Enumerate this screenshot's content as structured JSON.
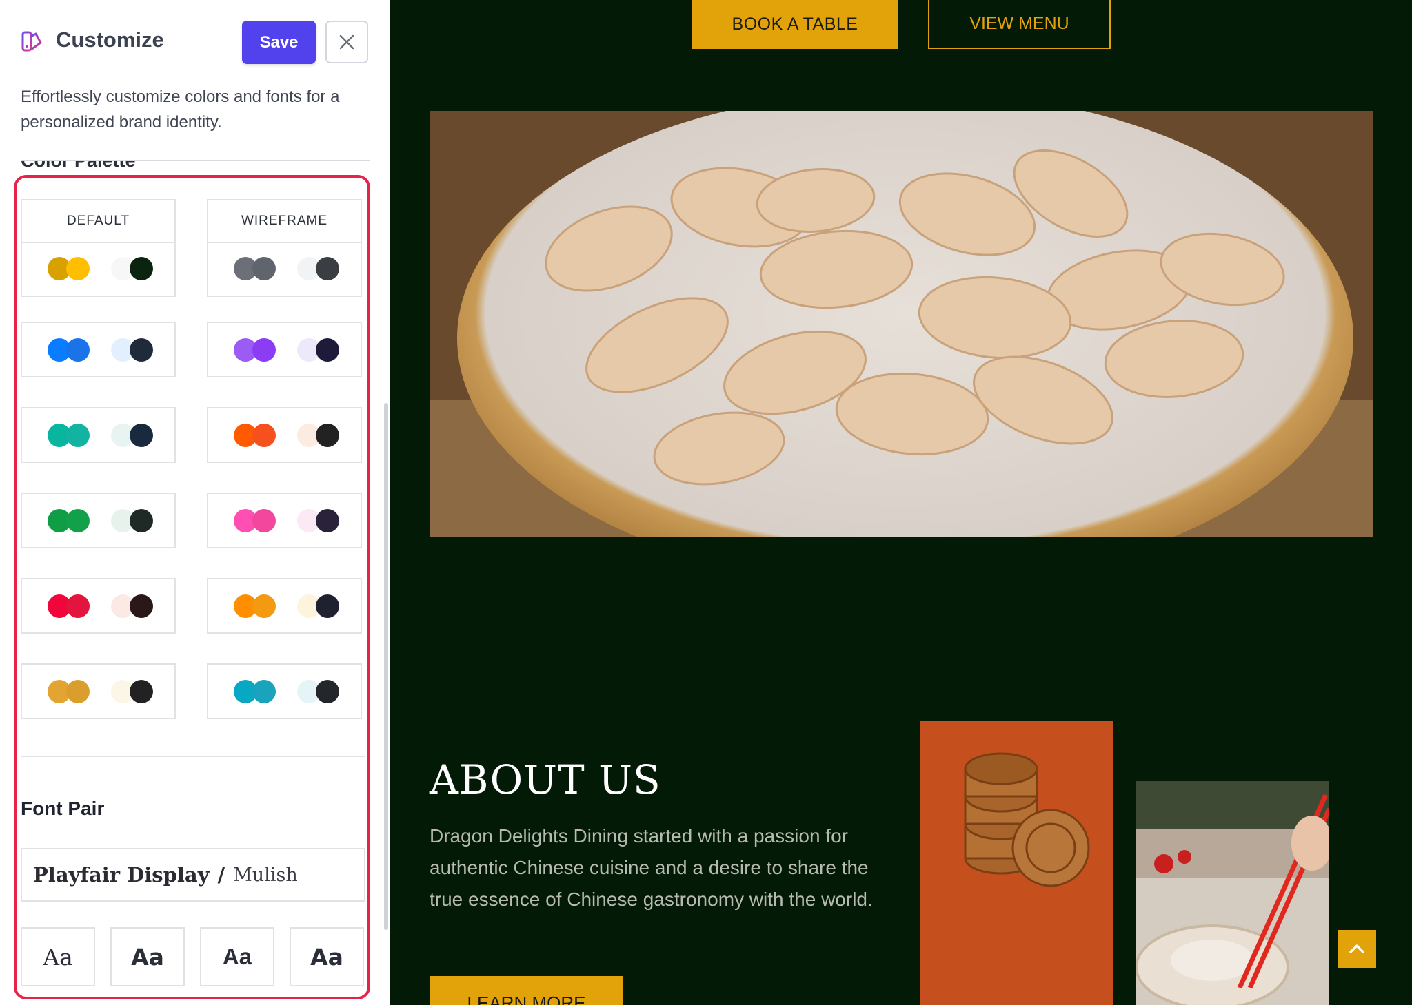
{
  "sidebar": {
    "title": "Customize",
    "save_label": "Save",
    "description": "Effortlessly customize colors and fonts for a personalized brand identity.",
    "color_palette_title": "Color Palette",
    "palettes": [
      {
        "label": "DEFAULT",
        "colors": [
          "#d9a100",
          "#ffbf00",
          "#f7f7f7",
          "#0a2410"
        ]
      },
      {
        "label": "WIREFRAME",
        "colors": [
          "#6b6f78",
          "#60646c",
          "#f2f3f4",
          "#3a3d42"
        ]
      },
      {
        "label": "",
        "colors": [
          "#0a7cff",
          "#1a73e8",
          "#e2f0fd",
          "#1f2a3b"
        ]
      },
      {
        "label": "",
        "colors": [
          "#9b5cf6",
          "#8b3cf4",
          "#ede8fb",
          "#1e1b3a"
        ]
      },
      {
        "label": "",
        "colors": [
          "#0ab5a0",
          "#12b3a0",
          "#e7f4f2",
          "#1a2a3e"
        ]
      },
      {
        "label": "",
        "colors": [
          "#ff5a00",
          "#f4511e",
          "#fcebe0",
          "#222222"
        ]
      },
      {
        "label": "",
        "colors": [
          "#0f9d46",
          "#12a14a",
          "#e8f2ec",
          "#1f2a26"
        ]
      },
      {
        "label": "",
        "colors": [
          "#ff4fb3",
          "#f2479c",
          "#fbe9f3",
          "#2a213b"
        ]
      },
      {
        "label": "",
        "colors": [
          "#f0063b",
          "#e3143e",
          "#fbe9e5",
          "#2a1818"
        ]
      },
      {
        "label": "",
        "colors": [
          "#ff8f00",
          "#f39a12",
          "#fcf4dc",
          "#1f2130"
        ]
      },
      {
        "label": "",
        "colors": [
          "#e4a431",
          "#d99e2c",
          "#fbf6e5",
          "#222222"
        ]
      },
      {
        "label": "",
        "colors": [
          "#06a8c4",
          "#1aa3bd",
          "#e5f5f7",
          "#23272c"
        ]
      }
    ],
    "font_pair_title": "Font Pair",
    "font_pair": {
      "primary": "Playfair Display",
      "separator": "/",
      "secondary": "Mulish"
    },
    "font_samples": [
      "Aa",
      "Aa",
      "Aa",
      "Aa"
    ]
  },
  "main": {
    "book_label": "BOOK A TABLE",
    "menu_label": "VIEW MENU",
    "about_title": "ABOUT US",
    "about_text": "Dragon Delights Dining started with a passion for authentic Chinese cuisine and a desire to share the true essence of Chinese gastronomy with the world.",
    "learn_label": "LEARN MORE"
  },
  "colors": {
    "accent": "#e1a20a",
    "page_bg": "#021a06",
    "save_bg": "#5142ee",
    "highlight": "#e8234a"
  }
}
